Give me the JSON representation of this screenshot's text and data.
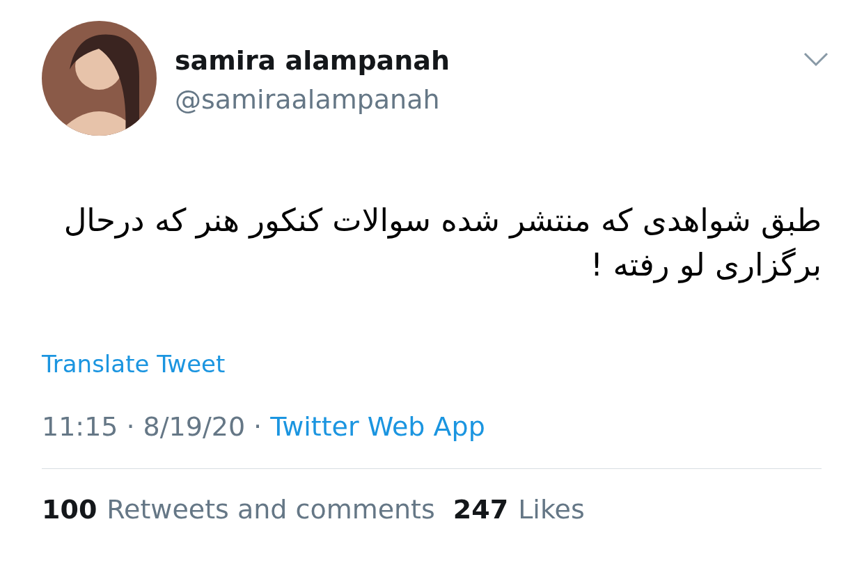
{
  "user": {
    "name": "samira alampanah",
    "handle": "@samiraalampanah"
  },
  "tweet_text": "طبق شواهدی که منتشر شده سوالات کنکور هنر که درحال برگزاری لو رفته !",
  "translate_link": "Translate Tweet",
  "meta": {
    "time": "11:15",
    "separator_1": "·",
    "date": "8/19/20",
    "separator_2": "·",
    "source": "Twitter Web App"
  },
  "stats": [
    {
      "count": "100",
      "label": "Retweets and comments"
    },
    {
      "count": "247",
      "label": "Likes"
    }
  ]
}
